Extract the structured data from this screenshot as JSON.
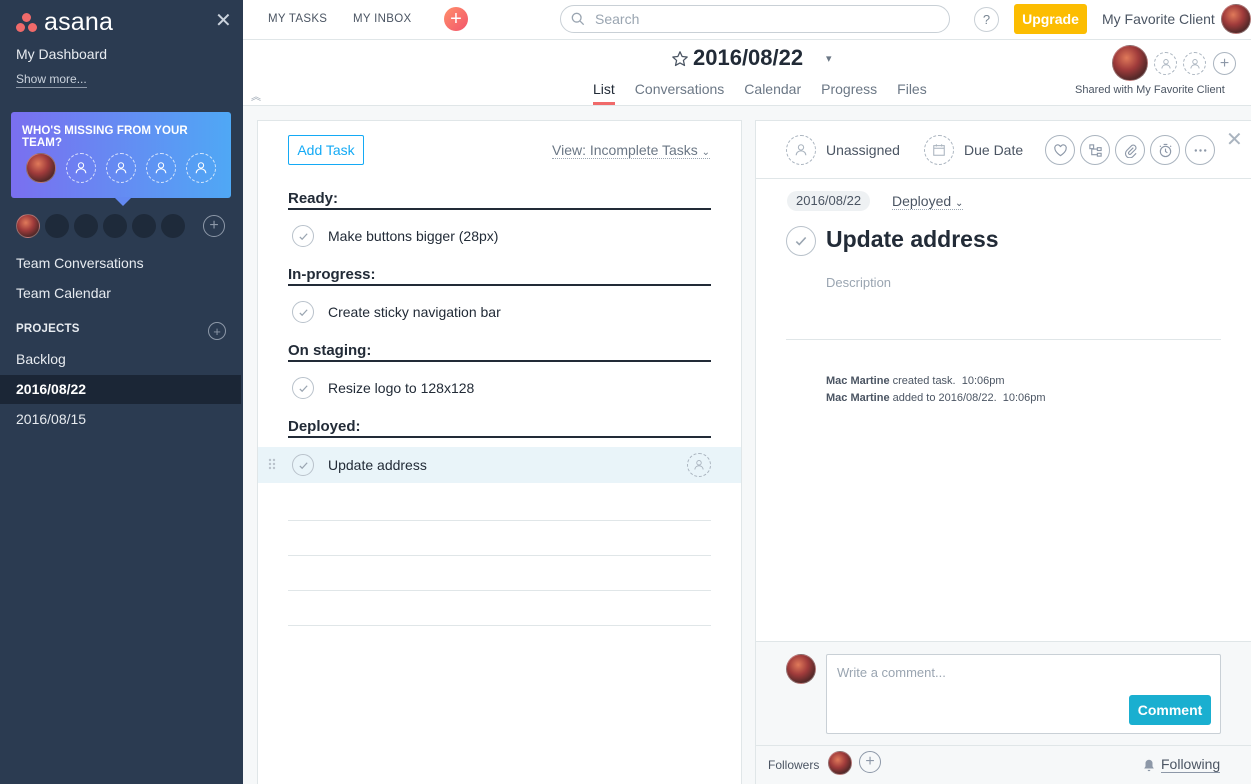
{
  "app": {
    "logo_text": "asana"
  },
  "sidebar": {
    "dashboard": "My Dashboard",
    "show_more": "Show more...",
    "missing_title": "WHO'S MISSING FROM YOUR TEAM?",
    "team_conversations": "Team Conversations",
    "team_calendar": "Team Calendar",
    "projects_label": "PROJECTS",
    "projects": [
      {
        "label": "Backlog"
      },
      {
        "label": "2016/08/22"
      },
      {
        "label": "2016/08/15"
      }
    ]
  },
  "topbar": {
    "my_tasks": "MY TASKS",
    "my_inbox": "MY INBOX",
    "search_placeholder": "Search",
    "help": "?",
    "upgrade": "Upgrade",
    "org_name": "My Favorite Client"
  },
  "project": {
    "title": "2016/08/22",
    "tabs": [
      "List",
      "Conversations",
      "Calendar",
      "Progress",
      "Files"
    ],
    "active_tab": "List",
    "shared_with": "Shared with My Favorite Client"
  },
  "list": {
    "add_task": "Add Task",
    "view_filter": "View: Incomplete Tasks",
    "sections": [
      {
        "name": "Ready:",
        "tasks": [
          "Make buttons bigger (28px)"
        ]
      },
      {
        "name": "In-progress:",
        "tasks": [
          "Create sticky navigation bar"
        ]
      },
      {
        "name": "On staging:",
        "tasks": [
          "Resize logo to 128x128"
        ]
      },
      {
        "name": "Deployed:",
        "tasks": [
          "Update address"
        ]
      }
    ]
  },
  "detail": {
    "assignee": "Unassigned",
    "due_date": "Due Date",
    "project_pill": "2016/08/22",
    "section": "Deployed",
    "title": "Update address",
    "description_placeholder": "Description",
    "activity": [
      {
        "user": "Mac Martine",
        "text": "created task.",
        "time": "10:06pm"
      },
      {
        "user": "Mac Martine",
        "text": "added to 2016/08/22.",
        "time": "10:06pm"
      }
    ],
    "comment_placeholder": "Write a comment...",
    "comment_button": "Comment",
    "followers_label": "Followers",
    "following": "Following"
  },
  "colors": {
    "sidebar_bg": "#2b3b51",
    "accent_coral": "#f06a6a",
    "upgrade": "#fcbd01",
    "comment_button": "#1aafd0",
    "add_task_border": "#14aaf5"
  },
  "icons": [
    "close-icon",
    "search-icon",
    "star-icon",
    "person-icon",
    "calendar-icon",
    "heart-icon",
    "subtask-icon",
    "attachment-icon",
    "timer-icon",
    "more-icon",
    "check-icon",
    "bell-icon",
    "drag-handle-icon"
  ]
}
